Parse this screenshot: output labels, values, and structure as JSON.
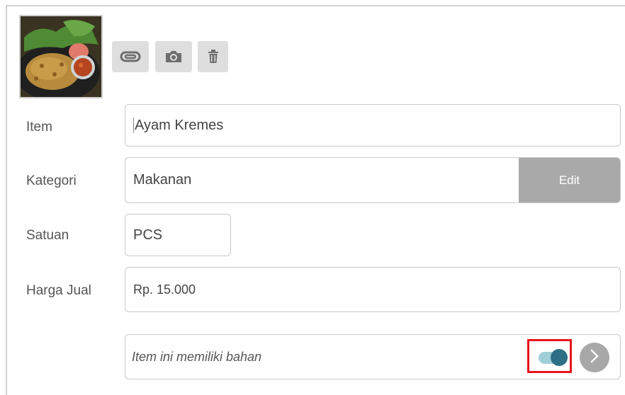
{
  "photo": {
    "alt": "Ayam Kremes photo"
  },
  "toolbar": {
    "attach_icon": "paperclip-icon",
    "camera_icon": "camera-icon",
    "delete_icon": "trash-icon"
  },
  "form": {
    "item_label": "Item",
    "item_value": "Ayam Kremes",
    "kategori_label": "Kategori",
    "kategori_value": "Makanan",
    "edit_label": "Edit",
    "satuan_label": "Satuan",
    "satuan_value": "PCS",
    "harga_label": "Harga Jual",
    "harga_value": "Rp. 15.000",
    "bahan_label": "Item ini memiliki bahan",
    "bahan_toggle_on": true
  },
  "colors": {
    "toggle_knob": "#2c6f86",
    "toggle_track": "#9fcfd6",
    "highlight": "#e8141b",
    "edit_button": "#a9a9a9"
  }
}
